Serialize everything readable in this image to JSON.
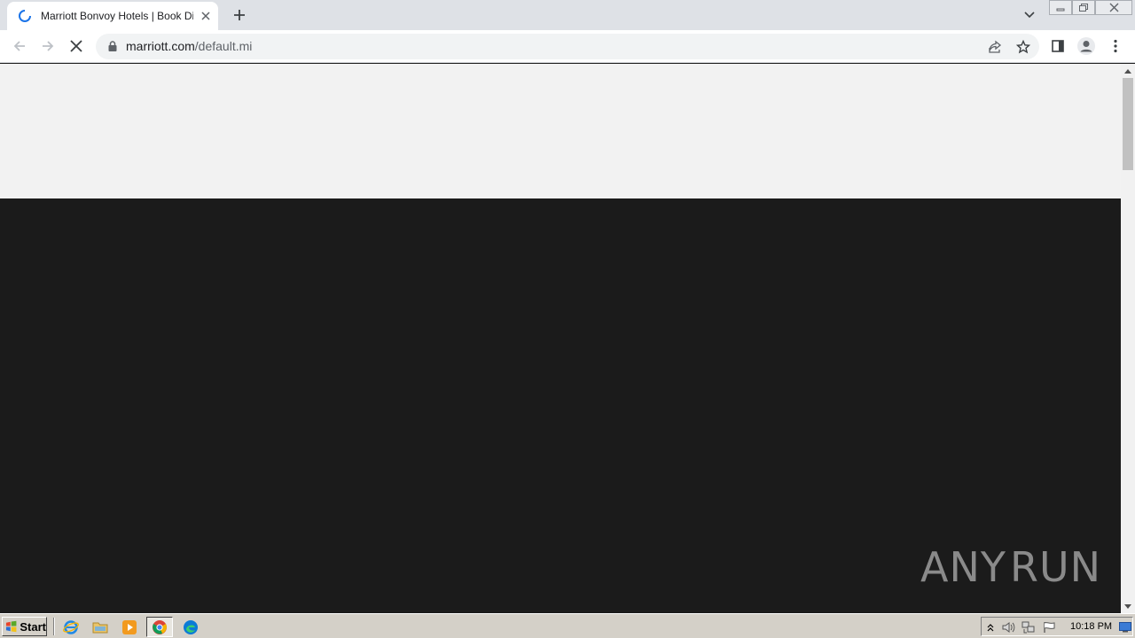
{
  "browser": {
    "tab": {
      "title": "Marriott Bonvoy Hotels | Book Direct"
    },
    "address": {
      "host": "marriott.com",
      "path": "/default.mi"
    }
  },
  "watermark": {
    "left": "ANY",
    "right": "RUN"
  },
  "taskbar": {
    "start_label": "Start",
    "clock": "10:18 PM"
  },
  "colors": {
    "tab_strip": "#dee1e6",
    "page_top": "#f2f2f2",
    "page_body": "#1b1b1b",
    "taskbar": "#d4d0c8"
  }
}
